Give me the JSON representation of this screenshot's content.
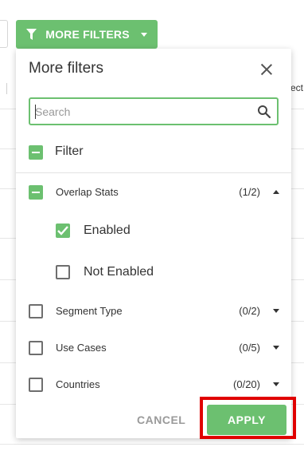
{
  "toolbar": {
    "more_filters_label": "MORE FILTERS",
    "background_column_fragment": "ect"
  },
  "panel": {
    "title": "More filters",
    "close_icon": "close-icon",
    "search": {
      "value": "",
      "placeholder": "Search",
      "icon": "search-icon"
    },
    "filter_all": {
      "label": "Filter",
      "state": "partial"
    },
    "groups": [
      {
        "label": "Overlap Stats",
        "count": "(1/2)",
        "expanded": true,
        "state": "partial",
        "options": [
          {
            "label": "Enabled",
            "checked": true
          },
          {
            "label": "Not Enabled",
            "checked": false
          }
        ]
      },
      {
        "label": "Segment Type",
        "count": "(0/2)",
        "expanded": false,
        "state": "empty"
      },
      {
        "label": "Use Cases",
        "count": "(0/5)",
        "expanded": false,
        "state": "empty"
      },
      {
        "label": "Countries",
        "count": "(0/20)",
        "expanded": false,
        "state": "empty"
      }
    ],
    "footer": {
      "cancel_label": "CANCEL",
      "apply_label": "APPLY"
    }
  },
  "colors": {
    "accent_green": "#6cc070",
    "highlight_red": "#e00000",
    "cancel_gray": "#9a9a9a"
  }
}
